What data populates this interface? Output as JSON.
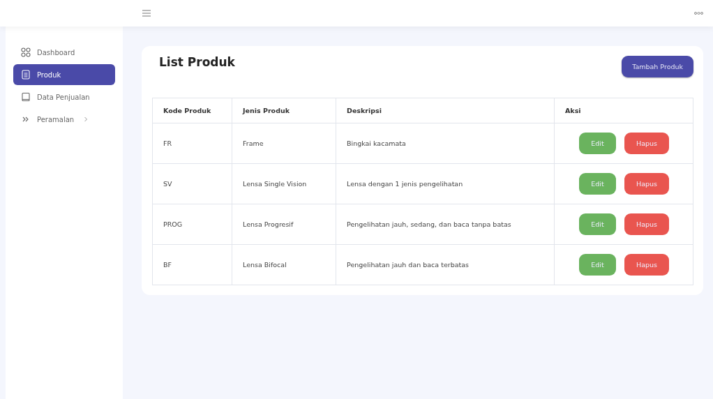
{
  "sidebar": {
    "items": [
      {
        "label": "Dashboard",
        "selected": false
      },
      {
        "label": "Produk",
        "selected": true
      },
      {
        "label": "Data Penjualan",
        "selected": false
      },
      {
        "label": "Peramalan",
        "selected": false,
        "expanded": false
      }
    ]
  },
  "page": {
    "title": "List Produk",
    "add_button": "Tambah Produk"
  },
  "table": {
    "columns": [
      "Kode Produk",
      "Jenis Produk",
      "Deskripsi",
      "Aksi"
    ],
    "rows": [
      {
        "code": "FR",
        "type": "Frame",
        "description": "Bingkai kacamata",
        "actions": [
          "Edit",
          "Hapus"
        ]
      },
      {
        "code": "SV",
        "type": "Lensa Single Vision",
        "description": "Lensa dengan 1 jenis pengelihatan",
        "actions": [
          "Edit",
          "Hapus"
        ]
      },
      {
        "code": "PROG",
        "type": "Lensa Progresif",
        "description": "Pengelihatan jauh, sedang, dan baca tanpa batas",
        "actions": [
          "Edit",
          "Hapus"
        ]
      },
      {
        "code": "BF",
        "type": "Lensa Bifocal",
        "description": "Pengelihatan jauh dan baca terbatas",
        "actions": [
          "Edit",
          "Hapus"
        ]
      }
    ]
  }
}
